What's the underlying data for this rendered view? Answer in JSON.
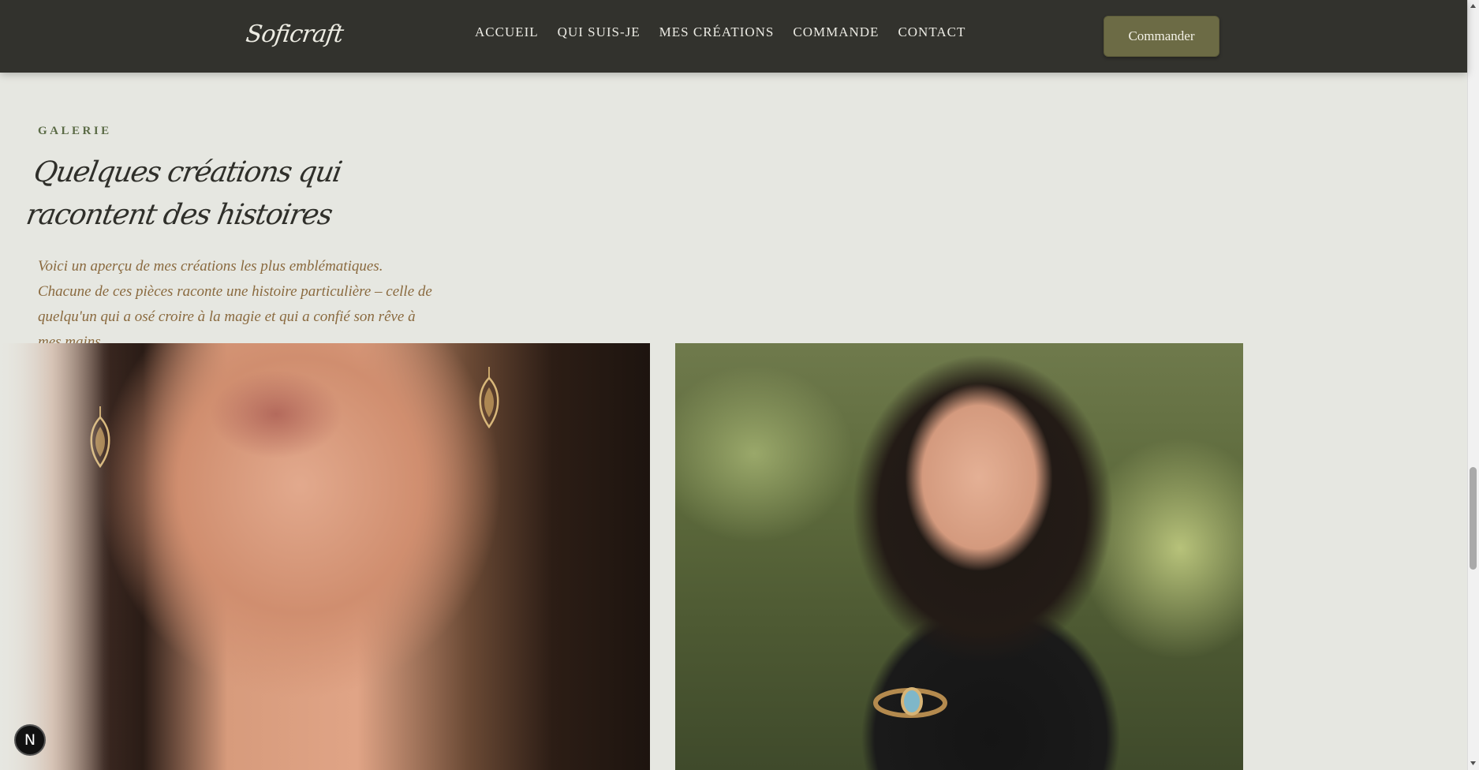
{
  "header": {
    "logo": "Soficraft",
    "nav": [
      "ACCUEIL",
      "QUI SUIS-JE",
      "MES CRÉATIONS",
      "COMMANDE",
      "CONTACT"
    ],
    "cta_label": "Commander"
  },
  "gallery": {
    "eyebrow": "GALERIE",
    "title": "Quelques créations qui racontent des histoires",
    "lead": "Voici un aperçu de mes créations les plus emblématiques. Chacune de ces pièces raconte une histoire particulière – celle de quelqu'un qui a osé croire à la magie et qui a confié son rêve à mes mains."
  },
  "badge": {
    "letter": "N"
  },
  "colors": {
    "header_bg": "#32322d",
    "page_bg": "#e6e7e1",
    "accent": "#6c6b45",
    "eyebrow": "#5b6b46",
    "lead_text": "#8a6a3f"
  }
}
